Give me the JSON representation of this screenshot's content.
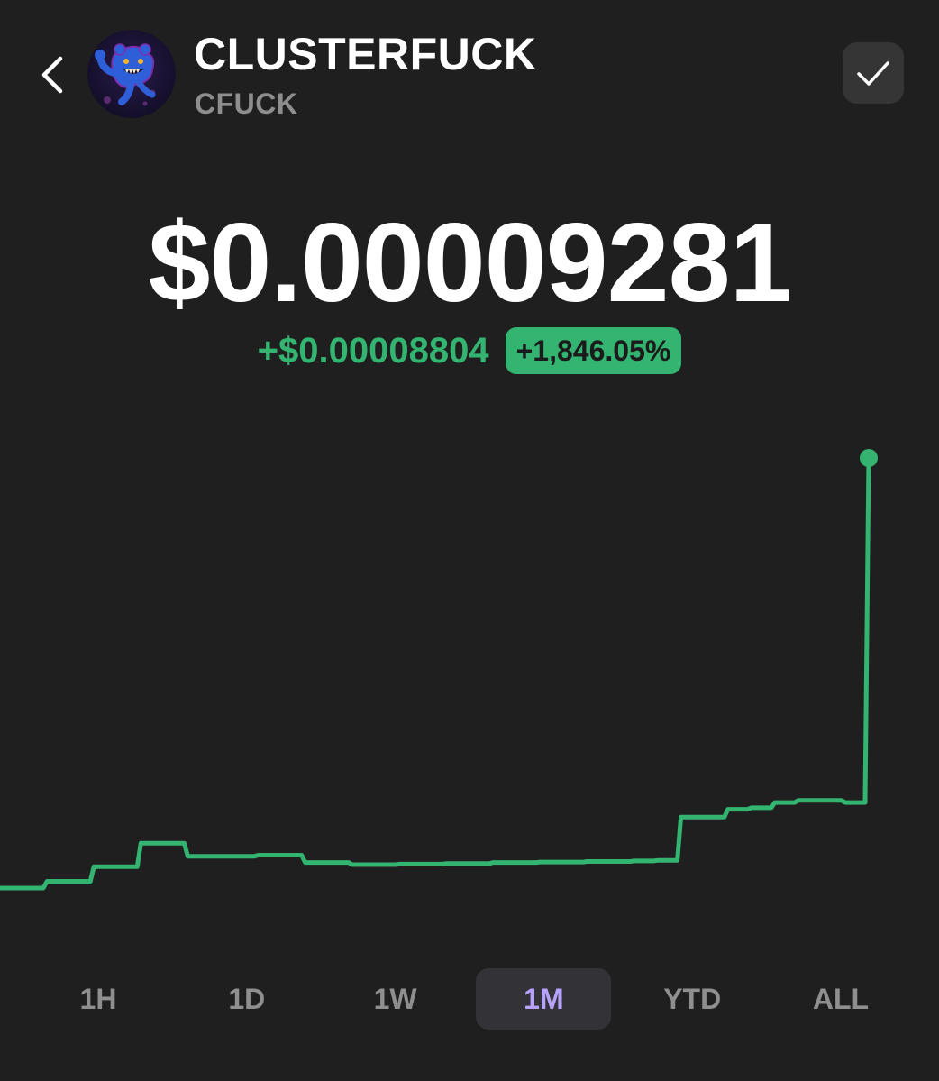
{
  "header": {
    "token_name": "CLUSTERFUCK",
    "token_symbol": "CFUCK"
  },
  "price": {
    "current": "$0.00009281",
    "change_abs": "+$0.00008804",
    "change_pct": "+1,846.05%"
  },
  "colors": {
    "background": "#1f1f1f",
    "positive": "#33b470",
    "accent_selected": "#b7a3ff",
    "muted": "#8f8f8f"
  },
  "icons": {
    "back": "chevron-left-icon",
    "watch": "checkmark-icon",
    "avatar": "token-avatar"
  },
  "ranges": {
    "selected": "1M",
    "items": [
      {
        "label": "1H"
      },
      {
        "label": "1D"
      },
      {
        "label": "1W"
      },
      {
        "label": "1M"
      },
      {
        "label": "YTD"
      },
      {
        "label": "ALL"
      }
    ]
  },
  "chart_data": {
    "type": "line",
    "step": true,
    "color": "#33b470",
    "grid": false,
    "end_marker": true,
    "x": [
      0,
      1,
      2,
      3,
      4,
      5,
      6,
      7,
      8,
      9,
      10,
      11,
      12,
      13,
      14,
      15,
      16,
      17,
      18,
      19,
      20,
      21,
      22,
      23,
      24,
      25,
      26,
      27,
      28,
      29,
      30,
      31,
      32,
      33,
      34,
      35,
      36,
      37
    ],
    "y": [
      1.04e-05,
      1.04e-05,
      1.17e-05,
      1.17e-05,
      1.45e-05,
      1.45e-05,
      1.9e-05,
      1.9e-05,
      1.65e-05,
      1.65e-05,
      1.65e-05,
      1.67e-05,
      1.67e-05,
      1.53e-05,
      1.53e-05,
      1.49e-05,
      1.49e-05,
      1.5e-05,
      1.5e-05,
      1.51e-05,
      1.51e-05,
      1.53e-05,
      1.53e-05,
      1.54e-05,
      1.54e-05,
      1.55e-05,
      1.55e-05,
      1.56e-05,
      1.57e-05,
      2.4e-05,
      2.4e-05,
      2.55e-05,
      2.58e-05,
      2.68e-05,
      2.72e-05,
      2.72e-05,
      2.68e-05,
      9.281e-05
    ]
  }
}
